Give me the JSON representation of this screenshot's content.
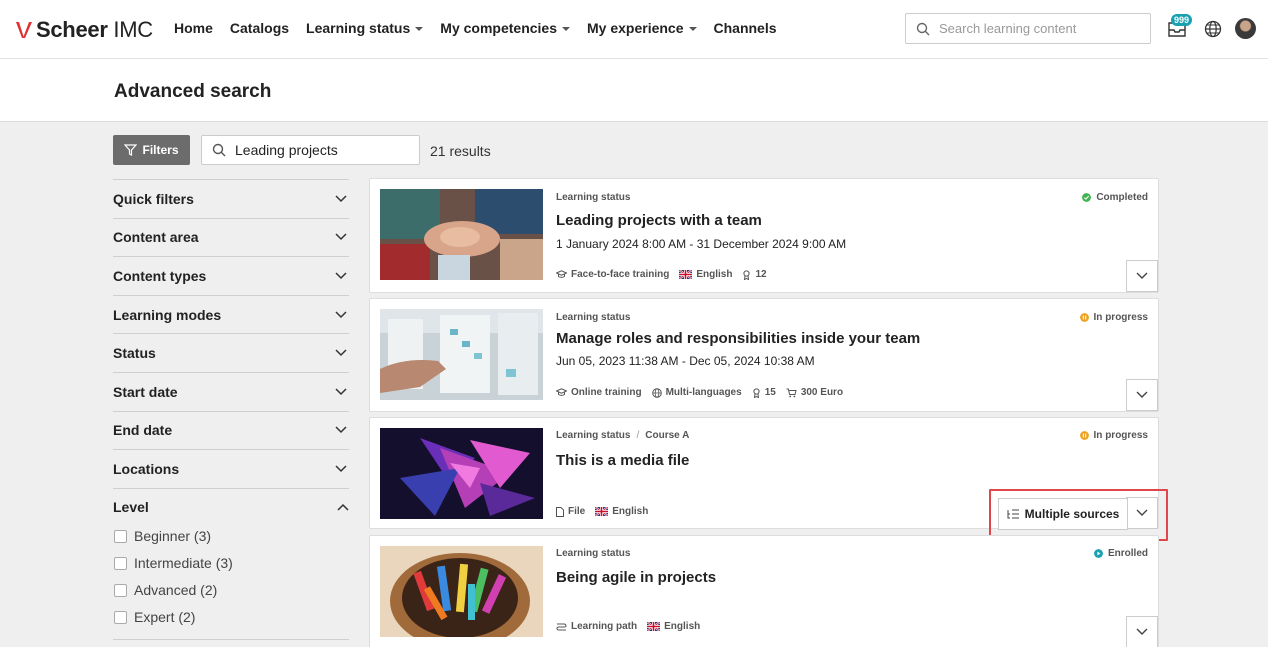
{
  "header": {
    "logo_brand": "Scheer",
    "logo_product": "IMC",
    "nav": [
      {
        "label": "Home",
        "has_dropdown": false
      },
      {
        "label": "Catalogs",
        "has_dropdown": false
      },
      {
        "label": "Learning status",
        "has_dropdown": true
      },
      {
        "label": "My competencies",
        "has_dropdown": true
      },
      {
        "label": "My experience",
        "has_dropdown": true
      },
      {
        "label": "Channels",
        "has_dropdown": false
      }
    ],
    "search_placeholder": "Search learning content",
    "inbox_badge": "999",
    "accent_color": "#1aa0b0",
    "brand_color": "#e0312f"
  },
  "page": {
    "title": "Advanced search"
  },
  "toolbar": {
    "filters_label": "Filters",
    "search_value": "Leading projects",
    "results": "21 results"
  },
  "sidebar": {
    "facets": [
      "Quick filters",
      "Content area",
      "Content types",
      "Learning modes",
      "Status",
      "Start date",
      "End date",
      "Locations"
    ],
    "level": {
      "label": "Level",
      "options": [
        "Beginner (3)",
        "Intermediate (3)",
        "Advanced (2)",
        "Expert (2)"
      ]
    }
  },
  "cards": [
    {
      "breadcrumb": [
        "Learning status"
      ],
      "status": "Completed",
      "status_color": "#3fb34f",
      "title": "Leading projects with a team",
      "date": "1 January 2024 8:00 AM - 31 December 2024 9:00 AM",
      "tags": [
        {
          "icon": "graduation-cap-icon",
          "label": "Face-to-face training"
        },
        {
          "icon": "uk-flag-icon",
          "label": "English"
        },
        {
          "icon": "medal-icon",
          "label": "12"
        }
      ]
    },
    {
      "breadcrumb": [
        "Learning status"
      ],
      "status": "In progress",
      "status_color": "#f0a020",
      "title": "Manage roles and responsibilities inside your team",
      "date": "Jun 05, 2023 11:38 AM - Dec 05, 2024 10:38 AM",
      "tags": [
        {
          "icon": "graduation-cap-icon",
          "label": "Online training"
        },
        {
          "icon": "globe-icon",
          "label": "Multi-languages"
        },
        {
          "icon": "medal-icon",
          "label": "15"
        },
        {
          "icon": "cart-icon",
          "label": "300 Euro"
        }
      ]
    },
    {
      "breadcrumb": [
        "Learning status",
        "Course A"
      ],
      "status": "In progress",
      "status_color": "#f0a020",
      "title": "This is a media file",
      "date": "",
      "tags": [
        {
          "icon": "file-icon",
          "label": "File"
        },
        {
          "icon": "uk-flag-icon",
          "label": "English"
        }
      ],
      "sources_label": "Multiple sources"
    },
    {
      "breadcrumb": [
        "Learning status"
      ],
      "status": "Enrolled",
      "status_color": "#1aa0b0",
      "title": "Being agile in projects",
      "date": "",
      "tags": [
        {
          "icon": "learning-path-icon",
          "label": "Learning path"
        },
        {
          "icon": "uk-flag-icon",
          "label": "English"
        }
      ]
    }
  ]
}
